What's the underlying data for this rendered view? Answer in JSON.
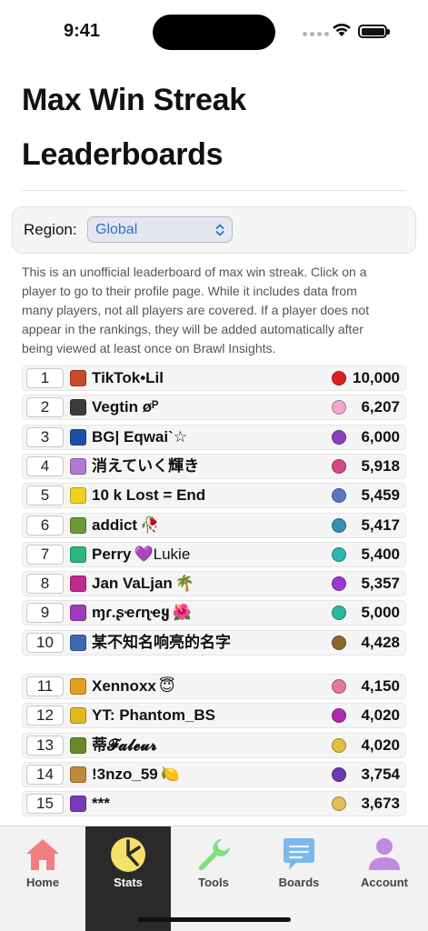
{
  "status_bar": {
    "time": "9:41"
  },
  "page": {
    "title": "Max Win Streak Leaderboards"
  },
  "region": {
    "label": "Region:",
    "selected": "Global"
  },
  "intro_text": "This is an unofficial leaderboard of max win streak. Click on a player to go to their profile page. While it includes data from many players, not all players are covered. If a player does not appear in the rankings, they will be added automatically after being viewed at least once on Brawl Insights.",
  "leaderboard": [
    {
      "rank": "1",
      "name": "TikTok•Lil",
      "emoji": "",
      "trophies": "10,000",
      "icon_color": "#c94a2a",
      "brawler_color": "#e02020"
    },
    {
      "rank": "2",
      "name": "Vegtin øᴾ",
      "emoji": "",
      "trophies": "6,207",
      "icon_color": "#3b3b3b",
      "brawler_color": "#f0a8c8"
    },
    {
      "rank": "3",
      "name": "BG| Eqwai`☆",
      "emoji": "",
      "trophies": "6,000",
      "icon_color": "#1e4fa8",
      "brawler_color": "#8a3fbf"
    },
    {
      "rank": "4",
      "name": "消えていく輝き",
      "emoji": "",
      "trophies": "5,918",
      "icon_color": "#b07ad0",
      "brawler_color": "#d04a8a"
    },
    {
      "rank": "5",
      "name": "10 k Lost = End",
      "emoji": "",
      "trophies": "5,459",
      "icon_color": "#f2d21c",
      "brawler_color": "#5a7ac0"
    },
    {
      "rank": "6",
      "name": "addict",
      "emoji": "🥀",
      "trophies": "5,417",
      "icon_color": "#6a9a3a",
      "brawler_color": "#3a8fb0"
    },
    {
      "rank": "7",
      "name": "Perry",
      "emoji": "💜Lukie",
      "trophies": "5,400",
      "icon_color": "#2ab87a",
      "brawler_color": "#2ab8b0"
    },
    {
      "rank": "8",
      "name": "Jan VaLjan",
      "emoji": "🌴",
      "trophies": "5,357",
      "icon_color": "#c02a8a",
      "brawler_color": "#9a3ad0"
    },
    {
      "rank": "9",
      "name": "ɱɾ.ʂҽɾɳҽყ",
      "emoji": "🌺",
      "trophies": "5,000",
      "icon_color": "#a03ac0",
      "brawler_color": "#2ab8a0"
    },
    {
      "rank": "10",
      "name": "某不知名响亮的名字",
      "emoji": "",
      "trophies": "4,428",
      "icon_color": "#3a6ab0",
      "brawler_color": "#8a6a2a"
    },
    {
      "rank": "11",
      "name": "Xennoxx",
      "emoji": "😇",
      "trophies": "4,150",
      "icon_color": "#e0a020",
      "brawler_color": "#e07a9a"
    },
    {
      "rank": "12",
      "name": "YT: Phantom_BS",
      "emoji": "",
      "trophies": "4,020",
      "icon_color": "#e0b820",
      "brawler_color": "#b02ab0"
    },
    {
      "rank": "13",
      "name": "蒂𝓕𝓪𝓵𝓮𝓾𝓻",
      "emoji": "",
      "trophies": "4,020",
      "icon_color": "#6a8a2a",
      "brawler_color": "#e0c040"
    },
    {
      "rank": "14",
      "name": "!3nzo_59",
      "emoji": "🍋",
      "trophies": "3,754",
      "icon_color": "#c08a3a",
      "brawler_color": "#6a3ab0"
    },
    {
      "rank": "15",
      "name": "***",
      "emoji": "",
      "trophies": "3,673",
      "icon_color": "#7a3ac0",
      "brawler_color": "#e0c050"
    }
  ],
  "tabs": [
    {
      "label": "Home",
      "icon": "house-icon",
      "color": "#f08080"
    },
    {
      "label": "Stats",
      "icon": "pie-chart-icon",
      "color": "#f5e06a"
    },
    {
      "label": "Tools",
      "icon": "wrench-icon",
      "color": "#80e080"
    },
    {
      "label": "Boards",
      "icon": "chat-bubble-icon",
      "color": "#7ab8f0"
    },
    {
      "label": "Account",
      "icon": "person-icon",
      "color": "#c08ae0"
    }
  ],
  "active_tab": "Stats"
}
